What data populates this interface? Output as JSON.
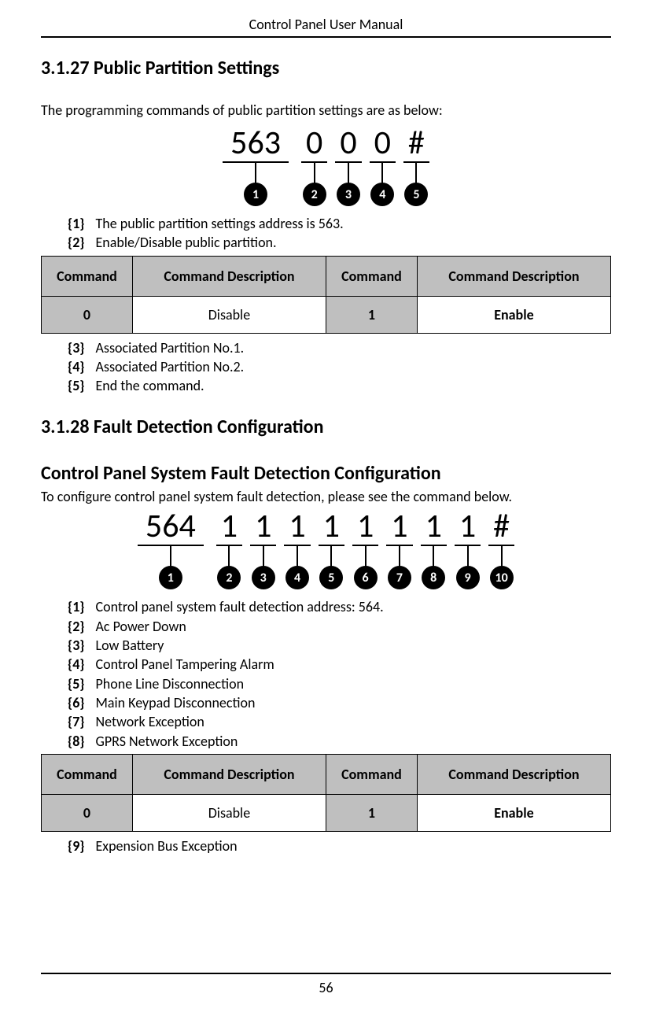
{
  "header": {
    "title": "Control Panel User Manual"
  },
  "s1": {
    "heading": "3.1.27 Public Partition Settings",
    "intro": "The programming commands of public partition settings are as below:",
    "tokens": [
      "563",
      "0",
      "0",
      "0",
      "#"
    ],
    "legend_before_table": [
      {
        "key": "{1}",
        "text": "The public partition settings address is 563."
      },
      {
        "key": "{2}",
        "text": "Enable/Disable public partition."
      }
    ],
    "table": {
      "headers": [
        "Command",
        "Command Description",
        "Command",
        "Command Description"
      ],
      "row": {
        "c1": "0",
        "c2": "Disable",
        "c3": "1",
        "c4": "Enable"
      }
    },
    "legend_after_table": [
      {
        "key": "{3}",
        "text": "Associated Partition No.1."
      },
      {
        "key": "{4}",
        "text": "Associated Partition No.2."
      },
      {
        "key": "{5}",
        "text": "End the command."
      }
    ]
  },
  "s2": {
    "heading": "3.1.28 Fault Detection Configuration",
    "subheading": "Control Panel System Fault Detection Configuration",
    "intro": "To configure control panel system fault detection, please see the command below.",
    "tokens": [
      "564",
      "1",
      "1",
      "1",
      "1",
      "1",
      "1",
      "1",
      "1",
      "#"
    ],
    "legend_before_table": [
      {
        "key": "{1}",
        "text": "Control panel system fault detection address: 564."
      },
      {
        "key": "{2}",
        "text": "Ac Power Down"
      },
      {
        "key": "{3}",
        "text": "Low Battery"
      },
      {
        "key": "{4}",
        "text": "Control Panel Tampering Alarm"
      },
      {
        "key": "{5}",
        "text": "Phone Line Disconnection"
      },
      {
        "key": "{6}",
        "text": "Main Keypad Disconnection"
      },
      {
        "key": "{7}",
        "text": "Network Exception"
      },
      {
        "key": "{8}",
        "text": "GPRS Network Exception"
      }
    ],
    "table": {
      "headers": [
        "Command",
        "Command Description",
        "Command",
        "Command Description"
      ],
      "row": {
        "c1": "0",
        "c2": "Disable",
        "c3": "1",
        "c4": "Enable"
      }
    },
    "legend_after_table": [
      {
        "key": "{9}",
        "text": "Expension Bus Exception"
      }
    ]
  },
  "page_number": "56"
}
